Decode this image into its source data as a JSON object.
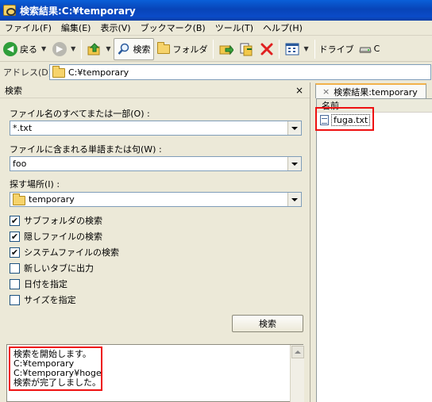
{
  "window": {
    "title": "検索結果:C:¥temporary"
  },
  "menu": [
    "ファイル(F)",
    "編集(E)",
    "表示(V)",
    "ブックマーク(B)",
    "ツール(T)",
    "ヘルプ(H)"
  ],
  "toolbar": {
    "back_label": "戻る",
    "search_label": "検索",
    "folder_label": "フォルダ",
    "drive_label": "ドライブ",
    "drive_c_label": "C"
  },
  "address": {
    "label": "アドレス(D)",
    "value": "C:¥temporary"
  },
  "search_panel": {
    "title": "検索",
    "close": "×",
    "filename_label": "ファイル名のすべてまたは一部(O) :",
    "filename_value": "*.txt",
    "phrase_label": "ファイルに含まれる単語または句(W) :",
    "phrase_value": "foo",
    "location_label": "探す場所(I) :",
    "location_value": "temporary",
    "options": [
      {
        "label": "サブフォルダの検索",
        "checked": true
      },
      {
        "label": "隠しファイルの検索",
        "checked": true
      },
      {
        "label": "システムファイルの検索",
        "checked": true
      },
      {
        "label": "新しいタブに出力",
        "checked": false
      },
      {
        "label": "日付を指定",
        "checked": false
      },
      {
        "label": "サイズを指定",
        "checked": false
      }
    ],
    "search_button": "検索",
    "log": [
      "検索を開始します。",
      "C:¥temporary",
      "C:¥temporary¥hoge",
      "検索が完了しました。"
    ]
  },
  "results": {
    "tab_label": "検索結果:temporary",
    "tab_close": "×",
    "column_name": "名前",
    "files": [
      "fuga.txt"
    ]
  },
  "colors": {
    "highlight": "#e11111",
    "title_bar": "#0a4bc8"
  }
}
